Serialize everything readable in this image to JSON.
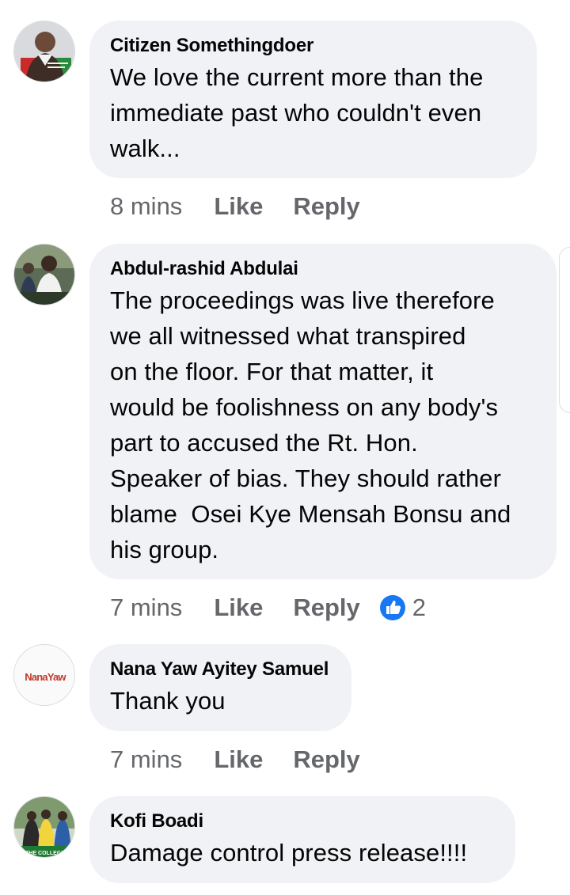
{
  "comments": [
    {
      "author": "Citizen Somethingdoer",
      "lines": [
        "We love the current more than the",
        "immediate past who couldn't even",
        "walk..."
      ],
      "time": "8 mins",
      "like_label": "Like",
      "reply_label": "Reply"
    },
    {
      "author": "Abdul-rashid Abdulai",
      "lines": [
        "The proceedings was live therefore",
        "we all witnessed what transpired",
        "on the floor. For that matter, it",
        "would be foolishness on any body's",
        "part to accused the Rt. Hon.",
        "Speaker of bias. They should rather",
        "blame  Osei Kye Mensah Bonsu and",
        "his group."
      ],
      "time": "7 mins",
      "like_label": "Like",
      "reply_label": "Reply",
      "reaction_icon": "like-thumb-icon",
      "reaction_count": "2"
    },
    {
      "author": "Nana Yaw Ayitey Samuel",
      "lines": [
        "Thank you"
      ],
      "time": "7 mins",
      "like_label": "Like",
      "reply_label": "Reply",
      "avatar_logo_text": "NanaYaw"
    },
    {
      "author": "Kofi Boadi",
      "lines": [
        "Damage control press release!!!!"
      ],
      "avatar_logo_text": "THE COLLEGE"
    }
  ],
  "colors": {
    "bubble": "#f0f2f5",
    "meta_text": "#65676b",
    "like_blue": "#1877f2"
  }
}
